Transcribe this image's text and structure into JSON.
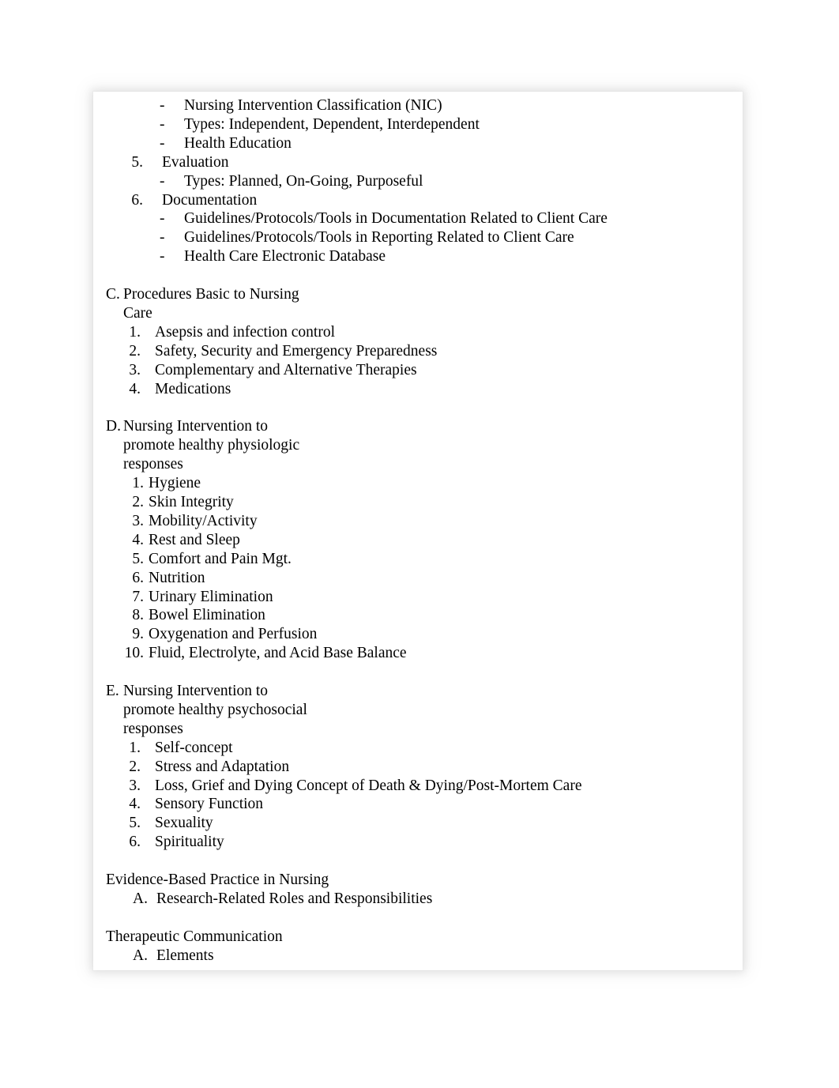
{
  "document": {
    "type": "outline",
    "text_color": "#000000",
    "page_background": "#ffffff"
  },
  "outline": {
    "top_fragment": {
      "dash_items_1": [
        "Nursing Intervention Classification (NIC)",
        "Types: Independent, Dependent, Interdependent",
        "Health Education"
      ],
      "item_5": {
        "marker": "5.",
        "text": "Evaluation"
      },
      "item_5_dashes": [
        "Types: Planned, On-Going, Purposeful"
      ],
      "item_6": {
        "marker": "6.",
        "text": "Documentation"
      },
      "item_6_dashes": [
        "Guidelines/Protocols/Tools in Documentation Related to Client Care",
        "Guidelines/Protocols/Tools in Reporting Related to Client Care",
        "Health Care Electronic Database"
      ]
    },
    "section_c": {
      "letter": "C.",
      "title_line_1": "Procedures Basic to Nursing",
      "title_line_2": "Care",
      "items": [
        {
          "marker": "1.",
          "text": "Asepsis and infection control"
        },
        {
          "marker": "2.",
          "text": "Safety, Security and Emergency Preparedness"
        },
        {
          "marker": "3.",
          "text": "Complementary and Alternative Therapies"
        },
        {
          "marker": "4.",
          "text": "Medications"
        }
      ]
    },
    "section_d": {
      "letter": "D.",
      "title_line_1": "Nursing Intervention to",
      "title_line_2": "promote healthy physiologic",
      "title_line_3": "responses",
      "items": [
        {
          "marker": "1.",
          "text": "Hygiene"
        },
        {
          "marker": "2.",
          "text": "Skin Integrity"
        },
        {
          "marker": "3.",
          "text": "Mobility/Activity"
        },
        {
          "marker": "4.",
          "text": "Rest and Sleep"
        },
        {
          "marker": "5.",
          "text": "Comfort and Pain Mgt."
        },
        {
          "marker": "6.",
          "text": "Nutrition"
        },
        {
          "marker": "7.",
          "text": "Urinary Elimination"
        },
        {
          "marker": "8.",
          "text": "Bowel Elimination"
        },
        {
          "marker": "9.",
          "text": "Oxygenation and Perfusion"
        },
        {
          "marker": "10.",
          "text": "Fluid, Electrolyte, and Acid Base Balance"
        }
      ]
    },
    "section_e": {
      "letter": "E.",
      "title_line_1": "Nursing Intervention to",
      "title_line_2": "promote healthy psychosocial",
      "title_line_3": "responses",
      "items": [
        {
          "marker": "1.",
          "text": "Self-concept"
        },
        {
          "marker": "2.",
          "text": "Stress and Adaptation"
        },
        {
          "marker": "3.",
          "text": "Loss, Grief and Dying Concept of Death & Dying/Post-Mortem Care"
        },
        {
          "marker": "4.",
          "text": "Sensory Function"
        },
        {
          "marker": "5.",
          "text": "Sexuality"
        },
        {
          "marker": "6.",
          "text": "Spirituality"
        }
      ]
    },
    "section_evidence": {
      "title": "Evidence-Based Practice in Nursing",
      "items": [
        {
          "marker": "A.",
          "text": "Research-Related Roles and Responsibilities"
        }
      ]
    },
    "section_therapeutic": {
      "title": "Therapeutic Communication",
      "items": [
        {
          "marker": "A.",
          "text": "Elements"
        }
      ]
    },
    "dash_marker": "-"
  }
}
